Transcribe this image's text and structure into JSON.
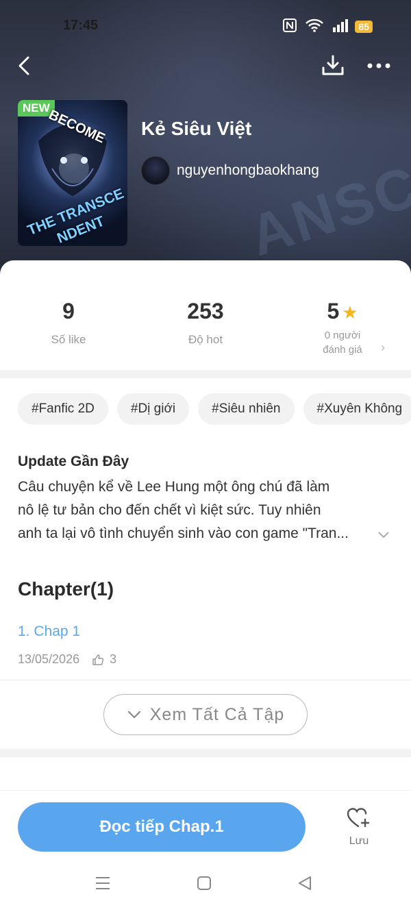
{
  "status_bar": {
    "time": "17:45",
    "battery": "85"
  },
  "header": {
    "back_icon": "chevron-left-icon",
    "download_icon": "download-icon",
    "more_icon": "more-horizontal-icon"
  },
  "story": {
    "badge": "NEW",
    "cover_text_top": "BECOME",
    "cover_text_line1": "THE TRANSCE",
    "cover_text_line2": "NDENT",
    "title": "Kẻ Siêu Việt",
    "author": "nguyenhongbaokhang",
    "watermark": "ANSCE"
  },
  "stats": [
    {
      "value": "9",
      "label": "Số like"
    },
    {
      "value": "253",
      "label": "Độ hot"
    },
    {
      "value": "5",
      "label_line1": "0 người",
      "label_line2": "đánh giá"
    }
  ],
  "tags": [
    "#Fanfic 2D",
    "#Dị giới",
    "#Siêu nhiên",
    "#Xuyên Không"
  ],
  "description": {
    "heading": "Update Gần Đây",
    "line1": "Câu chuyện kể về Lee Hung một ông chú đã làm",
    "line2": "nô lệ tư bản cho đến chết vì kiệt sức. Tuy nhiên",
    "line3": "anh ta lại vô tình chuyển sinh vào con game \"Tran..."
  },
  "chapters": {
    "heading": "Chapter(1)",
    "items": [
      {
        "title": "1. Chap 1",
        "date": "13/05/2026",
        "likes": "3"
      }
    ],
    "view_all": "Xem Tất Cả Tập"
  },
  "footer": {
    "read_button": "Đọc tiếp Chap.1",
    "save_label": "Lưu"
  },
  "colors": {
    "accent": "#5aa6ee",
    "star": "#f5b61e",
    "new_badge": "#5bc65a"
  }
}
